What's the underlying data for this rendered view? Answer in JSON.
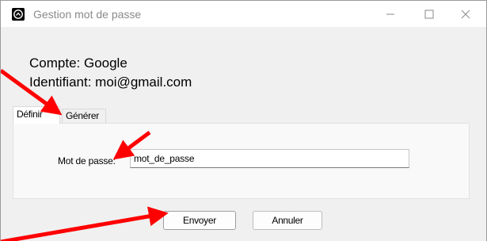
{
  "window": {
    "title": "Gestion mot de passe",
    "controls": {
      "minimize": "minimize",
      "maximize": "maximize",
      "close": "close"
    }
  },
  "account": {
    "service_line": "Compte: Google",
    "identifier_line": "Identifiant: moi@gmail.com"
  },
  "tabs": [
    {
      "label": "Définir",
      "selected": true
    },
    {
      "label": "Générer",
      "selected": false
    }
  ],
  "form": {
    "password_label": "Mot de passe:",
    "password_value": "mot_de_passe"
  },
  "buttons": {
    "send": "Envoyer",
    "cancel": "Annuler"
  },
  "colors": {
    "annotation_arrow": "#ff0000",
    "window_background": "#f0f0f0",
    "title_text": "#8a8a8a"
  },
  "icons": {
    "app": "app-logo-icon",
    "minimize": "minimize-icon",
    "maximize": "maximize-icon",
    "close": "close-icon"
  }
}
